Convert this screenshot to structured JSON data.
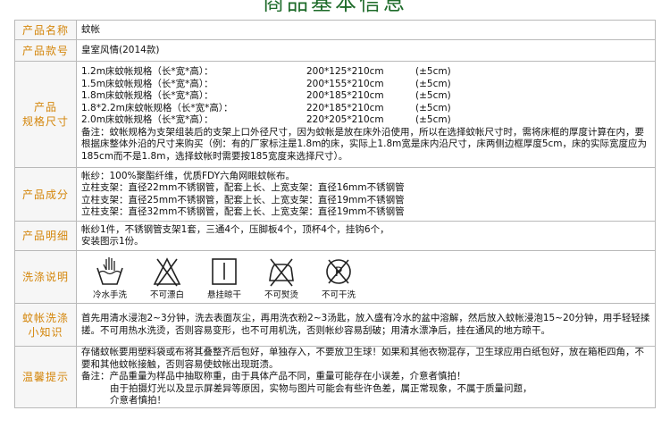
{
  "title": "商品基本信息",
  "rows": {
    "name": {
      "label": "产品名称",
      "value": "蚊帐"
    },
    "model": {
      "label": "产品款号",
      "value": "皇室风情(2014款)"
    },
    "spec": {
      "label_1": "产品",
      "label_2": "规格尺寸",
      "items": [
        {
          "name": "1.2m床蚊帐规格（长*宽*高）：",
          "size": "200*125*210cm",
          "tol": "(±5cm)"
        },
        {
          "name": "1.5m床蚊帐规格（长*宽*高）：",
          "size": "200*155*210cm",
          "tol": "(±5cm)"
        },
        {
          "name": "1.8m床蚊帐规格（长*宽*高）：",
          "size": "200*185*210cm",
          "tol": "(±5cm)"
        },
        {
          "name": "1.8*2.2m床蚊帐规格（长*宽*高）：",
          "size": "220*185*210cm",
          "tol": "(±5cm)"
        },
        {
          "name": "2.0m床蚊帐规格（长*宽*高）：",
          "size": "220*205*210cm",
          "tol": "(±5cm)"
        }
      ],
      "note": "备注：蚊帐规格为支架组装后的支架上口外径尺寸，因为蚊帐是放在床外沿使用，所以在选择蚊帐尺寸时，需将床框的厚度计算在内，要根据床整体外沿的尺寸来购买（例：有的厂家标注是1.8m的床，实际上1.8m宽是床内沿尺寸，床两侧边框厚度5cm，床的实际宽度应为185cm而不是1.8m，选择蚊帐时需要按185宽度来选择尺寸）。"
    },
    "material": {
      "label": "产品成分",
      "lines": [
        "帐纱：100%聚酯纤维，优质FDY六角网眼蚊帐布。",
        "立柱支架：直径22mm不锈钢管，配套上长、上宽支架：直径16mm不锈钢管",
        "立柱支架：直径25mm不锈钢管，配套上长、上宽支架：直径19mm不锈钢管",
        "立柱支架：直径32mm不锈钢管，配套上长、上宽支架：直径19mm不锈钢管"
      ]
    },
    "detail": {
      "label": "产品明细",
      "lines": [
        "帐纱1件，不锈钢管支架1套，三通4个，压脚板4个，顶杯4个，挂钩6个，",
        "安装图示1份。"
      ]
    },
    "wash": {
      "label": "洗涤说明",
      "icons": [
        {
          "icon": "hand-wash-icon",
          "text": "冷水手洗"
        },
        {
          "icon": "no-bleach-icon",
          "text": "不可漂白"
        },
        {
          "icon": "hang-dry-icon",
          "text": "悬挂晾干"
        },
        {
          "icon": "no-iron-icon",
          "text": "不可熨烫"
        },
        {
          "icon": "no-dry-clean-icon",
          "text": "不可干洗"
        }
      ]
    },
    "tips": {
      "label_1": "蚊帐洗涤",
      "label_2": "小知识",
      "text": "首先用清水浸泡2~3分钟，洗去表面灰尘，再用洗衣粉2~3汤匙，放入盛有冷水的盆中溶解，然后放入蚊帐浸泡15~20分钟，用手轻轻揉搓。不可用热水洗烫，否则容易变形，也不可用机洗，否则帐纱容易刮破；用清水漂净后，挂在通风的地方晾干。"
    },
    "warm": {
      "label": "温馨提示",
      "line1": "存储蚊帐要用塑料袋或布将其叠整齐后包好，单独存入，不要放卫生球！如果和其他衣物混存，卫生球应用白纸包好，放在箱柜四角，不要和其他蚊帐接触，否则容易使蚊帐出现斑渍。",
      "line2": "备注：产品重量为样品中抽取称重，由于具体产品不同，重量可能存在小误差，介意者慎拍！",
      "line3": "由于拍摄灯光以及显示屏差异等原因，实物与图片可能会有些许色差，属正常现象，不属于质量问题，",
      "line4": "介意者慎拍！"
    }
  }
}
